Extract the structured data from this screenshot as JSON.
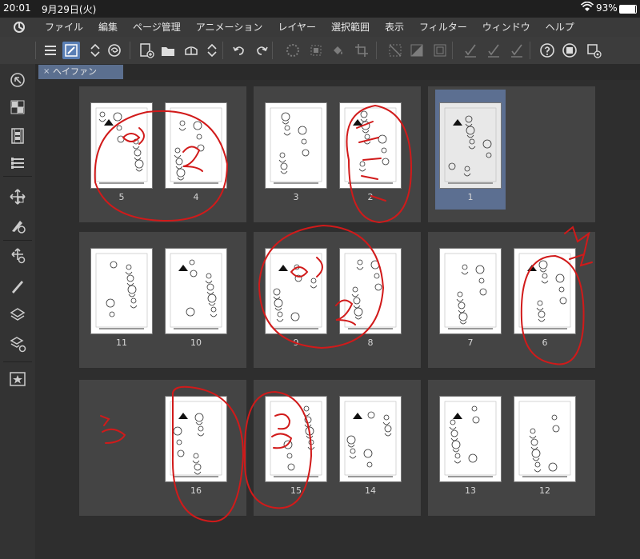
{
  "status_bar": {
    "time": "20:01",
    "date": "9月29日(火)",
    "battery": "93%",
    "battery_level": 0.93
  },
  "menu": {
    "items": [
      "ファイル",
      "編集",
      "ページ管理",
      "アニメーション",
      "レイヤー",
      "選択範囲",
      "表示",
      "フィルター",
      "ウィンドウ",
      "ヘルプ"
    ]
  },
  "toolbar": {
    "icons": [
      "hamburger-menu-icon",
      "edit-page-icon",
      "up-down-arrows-icon",
      "swirl-icon",
      "new-page-icon",
      "open-folder-icon",
      "save-cloud-icon",
      "up-down-arrows-icon",
      "undo-icon",
      "redo-icon",
      "loading-spinner-icon",
      "transform-icon",
      "fill-icon",
      "crop-icon",
      "deselect-icon",
      "invert-selection-icon",
      "selection-box-icon",
      "checkmark-pen-icon",
      "checkmark-pen-icon",
      "checkmark-pen-icon",
      "help-icon",
      "record-icon",
      "settings-icon"
    ]
  },
  "left_panel": {
    "icons": [
      "navigator-icon",
      "grid-icon",
      "film-icon",
      "list-icon",
      "move-icon",
      "brush-target-icon",
      "move-settings-icon",
      "pen-icon",
      "layers-icon",
      "layers-settings-icon",
      "star-icon"
    ]
  },
  "tab": {
    "close": "×",
    "title": "ヘイファン"
  },
  "spreads": [
    {
      "pages": [
        "5",
        "4"
      ]
    },
    {
      "pages": [
        "3",
        "2"
      ]
    },
    {
      "pages": [
        "1"
      ]
    },
    {
      "pages": [
        "11",
        "10"
      ]
    },
    {
      "pages": [
        "9",
        "8"
      ]
    },
    {
      "pages": [
        "7",
        "6"
      ]
    },
    {
      "pages": [
        "16"
      ]
    },
    {
      "pages": [
        "15",
        "14"
      ]
    },
    {
      "pages": [
        "13",
        "12"
      ]
    }
  ],
  "colors": {
    "accent": "#5a7fb5",
    "selection": "#5c6f91",
    "ink": "#d11a1a"
  }
}
